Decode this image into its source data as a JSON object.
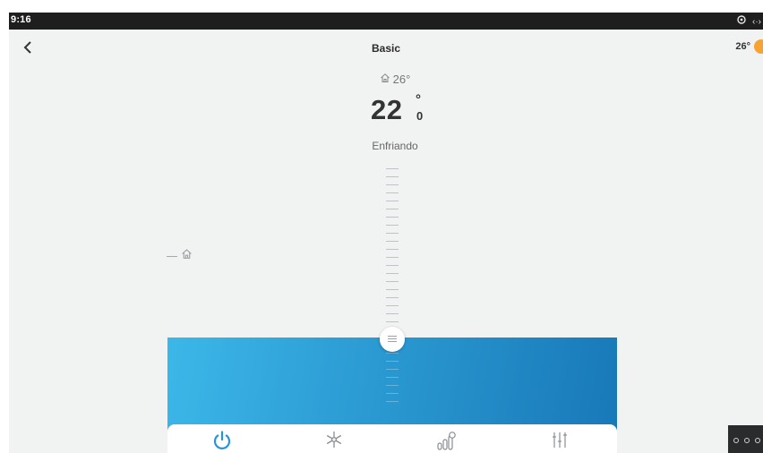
{
  "status": {
    "time": "9:16",
    "icons": [
      "target-icon",
      "arrows-icon"
    ]
  },
  "header": {
    "title": "Basic",
    "back_icon": "chevron-left-icon"
  },
  "weather": {
    "temperature": "26°",
    "icon": "sun-icon",
    "color": "#f7a233"
  },
  "thermostat": {
    "indoor_temperature": "26°",
    "setpoint": "22",
    "setpoint_degree": "°",
    "setpoint_decimal": "0",
    "mode": "Enfriando",
    "slider_level": 0.42
  },
  "bottom_nav": {
    "items": [
      {
        "name": "power",
        "icon": "power-icon"
      },
      {
        "name": "cooling-mode",
        "icon": "snowflake-icon"
      },
      {
        "name": "statistics",
        "icon": "bar-chart-icon"
      },
      {
        "name": "settings",
        "icon": "sliders-icon"
      }
    ]
  },
  "colors": {
    "accent": "#1e90d2",
    "panel_start": "#3cb7e8",
    "panel_end": "#1878b8"
  }
}
